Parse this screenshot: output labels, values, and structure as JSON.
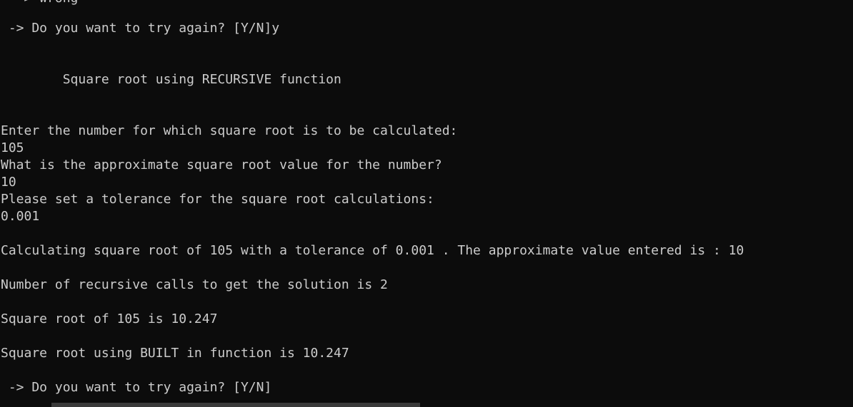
{
  "console": {
    "clipped_top_line": "  -> wrong",
    "lines": [
      " -> Do you want to try again? [Y/N]y",
      "        Square root using RECURSIVE function",
      "Enter the number for which square root is to be calculated:",
      "105",
      "What is the approximate square root value for the number?",
      "10",
      "Please set a tolerance for the square root calculations:",
      "0.001",
      "Calculating square root of 105 with a tolerance of 0.001 . The approximate value entered is : 10",
      "Number of recursive calls to get the solution is 2",
      "Square root of 105 is 10.247",
      "Square root using BUILT in function is 10.247",
      " -> Do you want to try again? [Y/N]"
    ]
  }
}
